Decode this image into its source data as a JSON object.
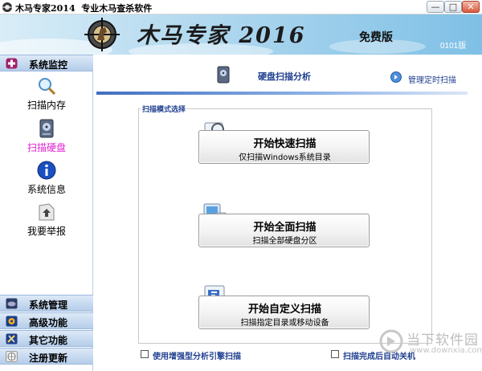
{
  "window": {
    "title": "木马专家2014  专业木马查杀软件",
    "minimize": "—",
    "maximize": "□",
    "close": "✕"
  },
  "banner": {
    "brand": "木马专家 2016",
    "edition": "免费版",
    "version": "0101版"
  },
  "sidebar": {
    "sections": [
      {
        "label": "系统监控",
        "icon": "shield-cross-icon"
      },
      {
        "label": "系统管理",
        "icon": "gamepad-icon"
      },
      {
        "label": "高级功能",
        "icon": "gear-icon"
      },
      {
        "label": "其它功能",
        "icon": "tools-icon"
      },
      {
        "label": "注册更新",
        "icon": "globe-icon"
      }
    ],
    "items": [
      {
        "label": "扫描内存",
        "icon": "magnifier-icon"
      },
      {
        "label": "扫描硬盘",
        "icon": "harddisk-icon",
        "active": true
      },
      {
        "label": "系统信息",
        "icon": "info-icon"
      },
      {
        "label": "我要举报",
        "icon": "report-icon"
      }
    ]
  },
  "main": {
    "title": "硬盘扫描分析",
    "schedule_link": "管理定时扫描",
    "group_title": "扫描模式选择",
    "buttons": [
      {
        "title": "开始快速扫描",
        "subtitle": "仅扫描Windows系统目录"
      },
      {
        "title": "开始全面扫描",
        "subtitle": "扫描全部硬盘分区"
      },
      {
        "title": "开始自定义扫描",
        "subtitle": "扫描指定目录或移动设备"
      }
    ],
    "options": [
      {
        "label": "使用增强型分析引擎扫描",
        "checked": false
      },
      {
        "label": "扫描完成后自动关机",
        "checked": false
      }
    ]
  },
  "watermark": {
    "text": "当下软件园",
    "url": "www.downxia.com"
  },
  "colors": {
    "accent": "#1f3f8f",
    "active_item": "#e020d0",
    "sidebar_header": "#b4cdea"
  }
}
